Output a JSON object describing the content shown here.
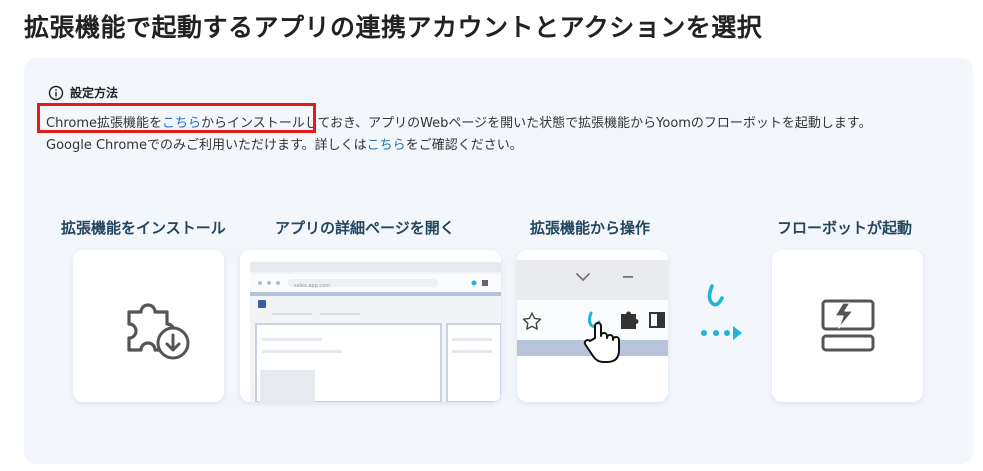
{
  "page": {
    "title": "拡張機能で起動するアプリの連携アカウントとアクションを選択"
  },
  "setup": {
    "heading": "設定方法",
    "line1": {
      "part1": "Chrome拡張機能を",
      "link1": "こちら",
      "part2": "からインストールしておき、アプリのWebページを開いた状態で拡張機能からYoomのフローボットを起動します。"
    },
    "line2": {
      "part1": "Google Chromeでのみご利用いただけます。詳しくは",
      "link1": "こちら",
      "part2": "をご確認ください。"
    }
  },
  "steps": [
    {
      "label": "拡張機能をインストール",
      "icon": "puzzle-download-icon"
    },
    {
      "label": "アプリの詳細ページを開く",
      "icon": "browser-window-icon"
    },
    {
      "label": "拡張機能から操作",
      "icon": "extension-toolbar-icon"
    },
    {
      "label": "フローボットが起動",
      "icon": "flowbot-launch-icon"
    }
  ],
  "browser_mock": {
    "url": "sales.app.com"
  },
  "colors": {
    "title": "#222222",
    "panel_bg": "#f3f7fc",
    "step_label": "#23465e",
    "link": "#1d6fb8",
    "accent": "#1fb5d6",
    "highlight": "#e31b1b"
  }
}
